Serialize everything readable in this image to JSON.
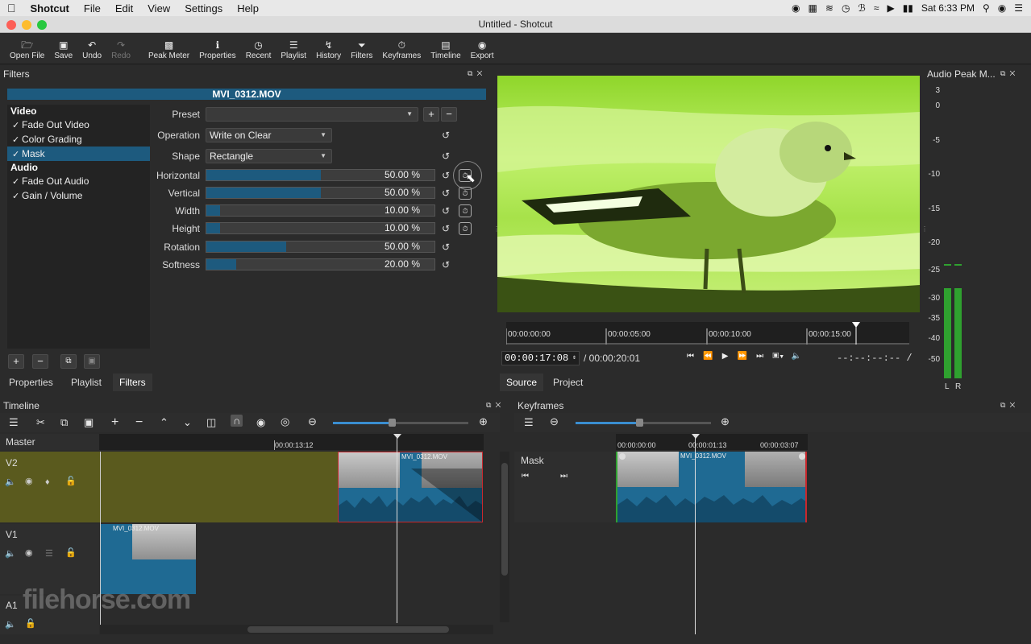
{
  "menubar": {
    "app_name": "Shotcut",
    "items": [
      "File",
      "Edit",
      "View",
      "Settings",
      "Help"
    ],
    "clock": "Sat 6:33 PM"
  },
  "window": {
    "title": "Untitled - Shotcut"
  },
  "toolbar": {
    "open_file": "Open File",
    "save": "Save",
    "undo": "Undo",
    "redo": "Redo",
    "peak_meter": "Peak Meter",
    "properties": "Properties",
    "recent": "Recent",
    "playlist": "Playlist",
    "history": "History",
    "filters": "Filters",
    "keyframes": "Keyframes",
    "timeline": "Timeline",
    "export": "Export"
  },
  "filters_panel": {
    "title": "Filters",
    "clip_name": "MVI_0312.MOV",
    "video_header": "Video",
    "audio_header": "Audio",
    "video_filters": [
      "Fade Out Video",
      "Color Grading",
      "Mask"
    ],
    "audio_filters": [
      "Fade Out Audio",
      "Gain / Volume"
    ],
    "selected_filter": "Mask",
    "preset_label": "Preset",
    "preset_value": "",
    "operation_label": "Operation",
    "operation_value": "Write on Clear",
    "shape_label": "Shape",
    "shape_value": "Rectangle",
    "params": [
      {
        "label": "Horizontal",
        "value": "50.00 %",
        "fraction": 0.5
      },
      {
        "label": "Vertical",
        "value": "50.00 %",
        "fraction": 0.5
      },
      {
        "label": "Width",
        "value": "10.00 %",
        "fraction": 0.06
      },
      {
        "label": "Height",
        "value": "10.00 %",
        "fraction": 0.06
      },
      {
        "label": "Rotation",
        "value": "50.00 %",
        "fraction": 0.35
      },
      {
        "label": "Softness",
        "value": "20.00 %",
        "fraction": 0.13
      }
    ],
    "tabs": [
      "Properties",
      "Playlist",
      "Filters"
    ],
    "active_tab": "Filters"
  },
  "player": {
    "ruler_labels": [
      "00:00:00:00",
      "00:00:05:00",
      "00:00:10:00",
      "00:00:15:00"
    ],
    "current_time": "00:00:17:08",
    "duration": "/ 00:00:20:01",
    "in_out": "--:--:--:-- /",
    "tabs": [
      "Source",
      "Project"
    ],
    "active_tab": "Source"
  },
  "audio_meter": {
    "title": "Audio Peak M...",
    "scale": [
      "3",
      "0",
      "-5",
      "-10",
      "-15",
      "-20",
      "-25",
      "-30",
      "-35",
      "-40",
      "-50"
    ],
    "channels": [
      "L",
      "R"
    ]
  },
  "timeline": {
    "title": "Timeline",
    "master_label": "Master",
    "ruler_label": "00:00:13:12",
    "tracks": [
      "V2",
      "V1",
      "A1"
    ],
    "clip_name": "MVI_0312.MOV"
  },
  "keyframes": {
    "title": "Keyframes",
    "ruler_labels": [
      "00:00:00:00",
      "00:00:01:13",
      "00:00:03:07"
    ],
    "track_label": "Mask",
    "clip_name": "MVI_0312.MOV"
  },
  "watermark": "filehorse.com",
  "colors": {
    "accent": "#1d5a7e",
    "v2_track": "#5a5a1e",
    "meter_green": "#2fa12f",
    "clip_red_border": "#c8282d"
  }
}
